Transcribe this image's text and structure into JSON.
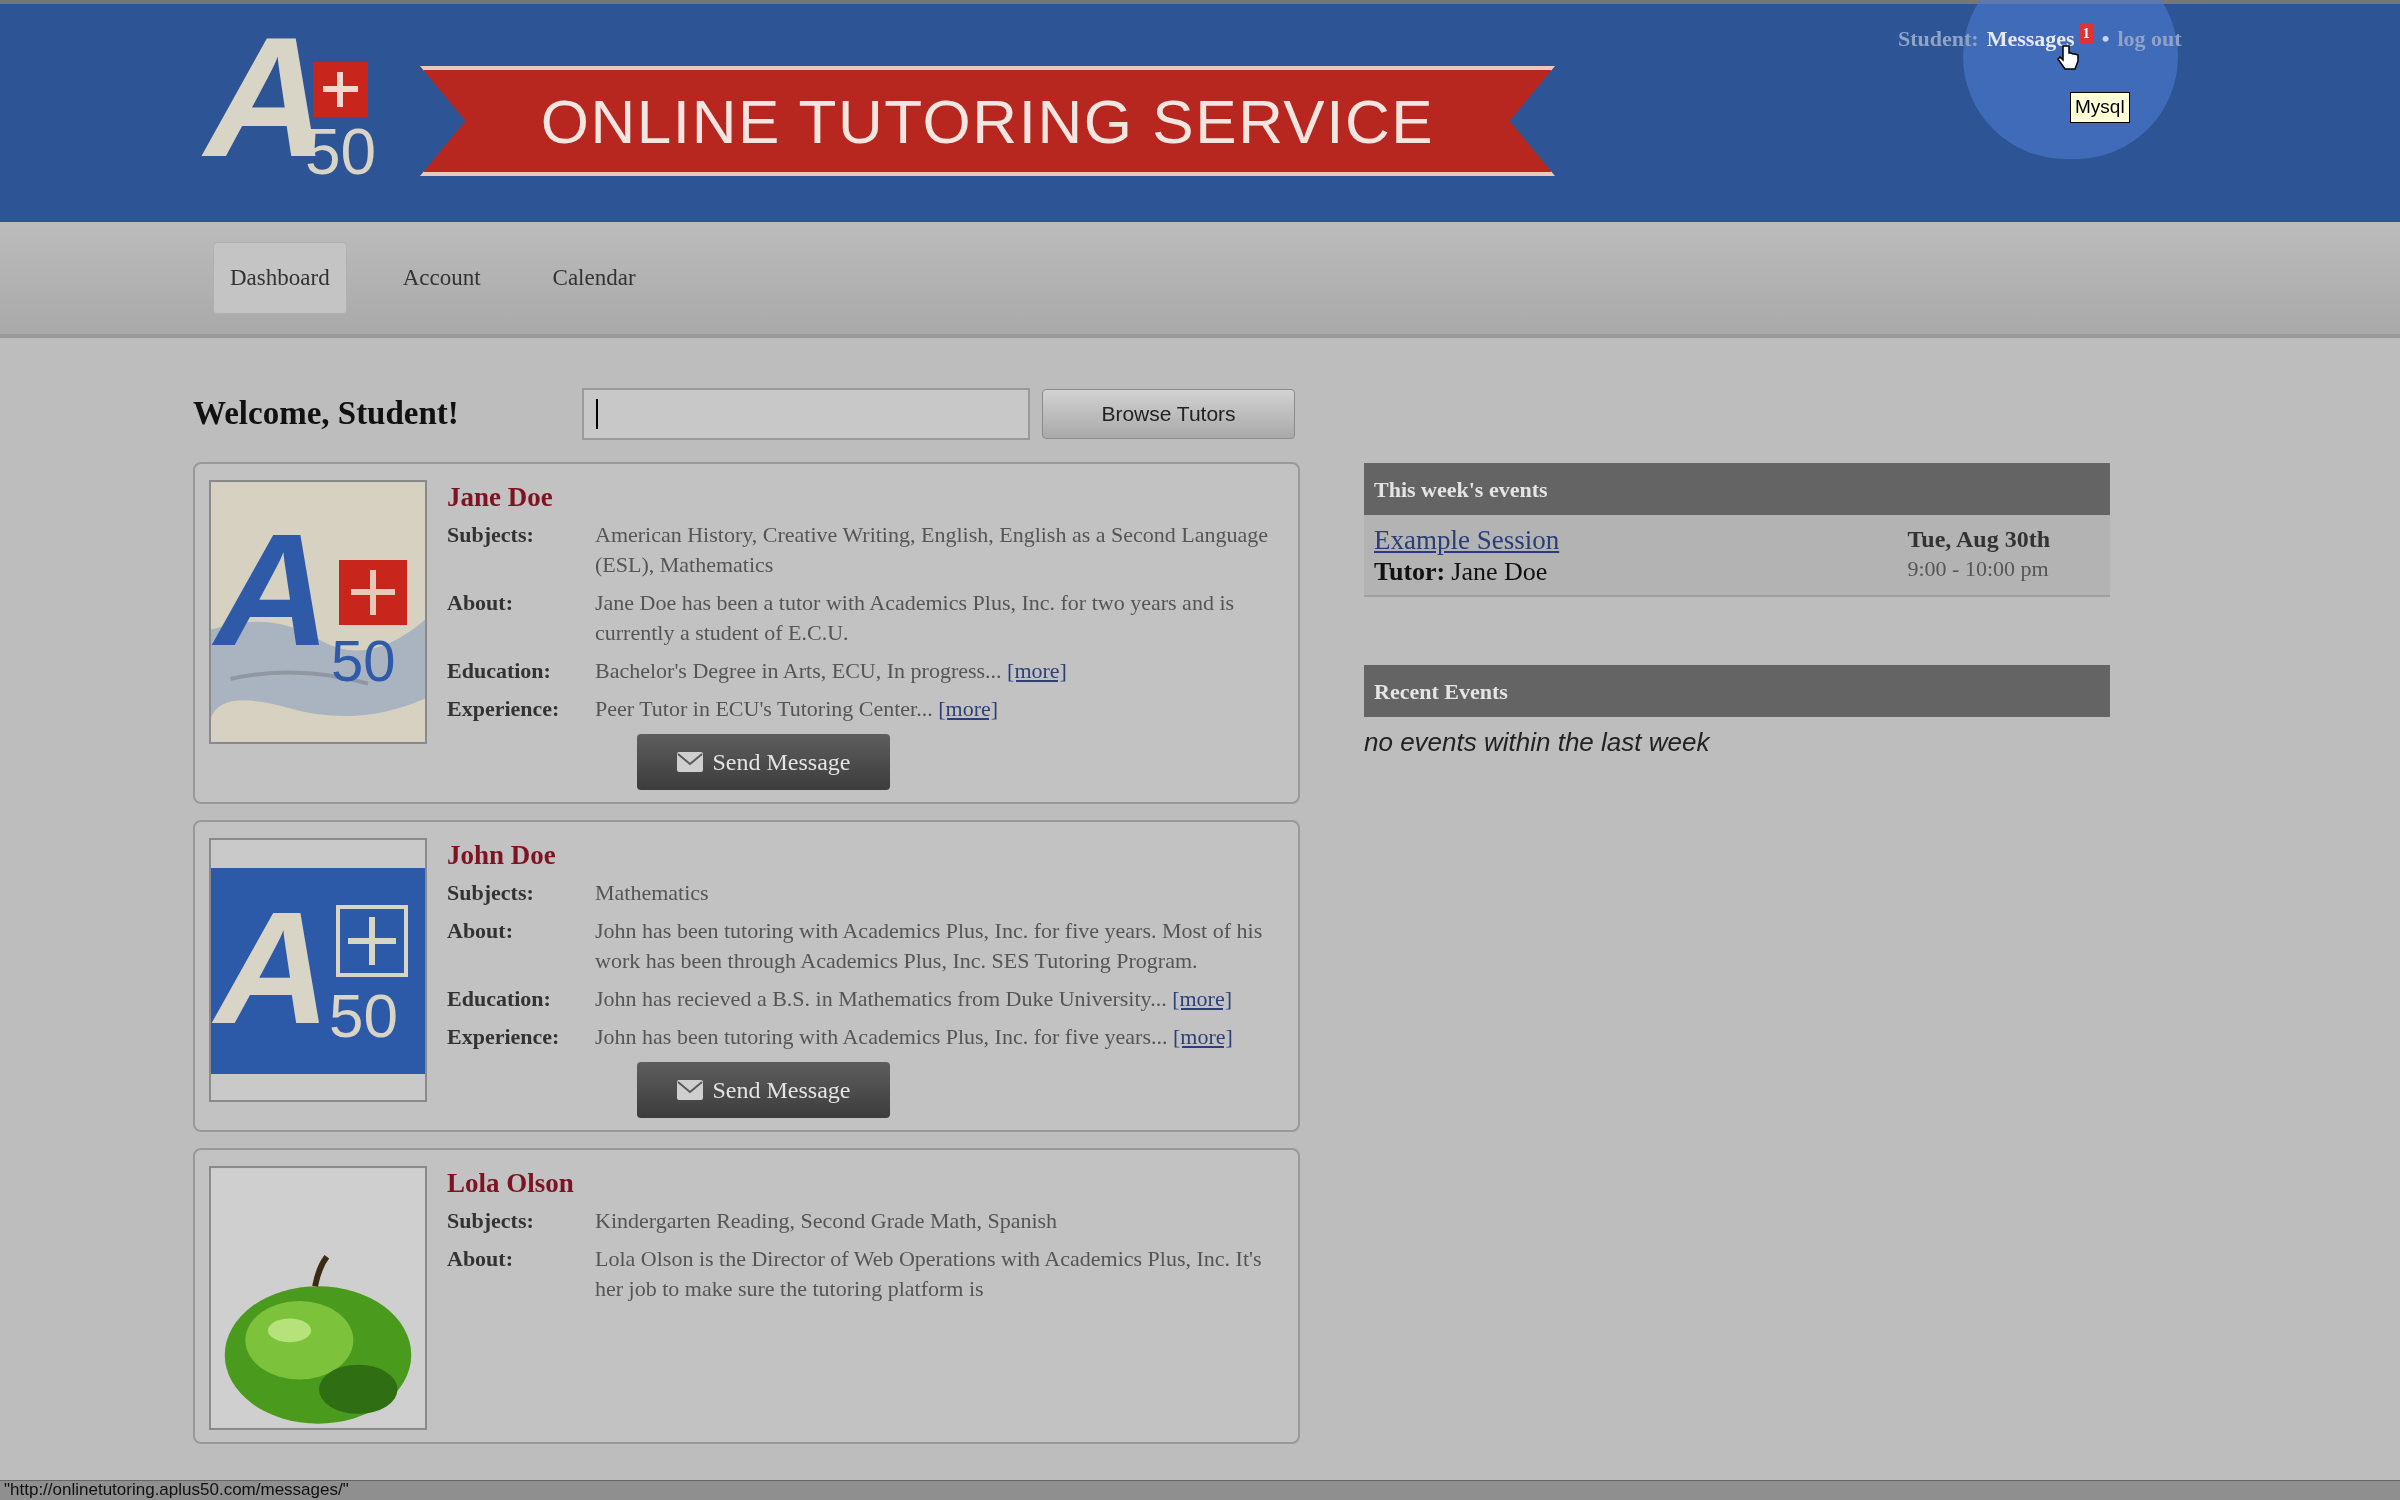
{
  "header": {
    "logo": {
      "letter": "A",
      "number": "50"
    },
    "banner": "ONLINE TUTORING SERVICE",
    "user_links": {
      "user": "Student:",
      "messages": "Messages",
      "badge": "1",
      "separator": "•",
      "logout": "log out"
    },
    "tooltip": "Mysql"
  },
  "nav": [
    {
      "label": "Dashboard",
      "selected": true
    },
    {
      "label": "Account",
      "selected": false
    },
    {
      "label": "Calendar",
      "selected": false
    }
  ],
  "welcome": "Welcome, Student!",
  "search": {
    "button": "Browse Tutors"
  },
  "tutors": [
    {
      "name": "Jane Doe",
      "avatar": {
        "kind": "logo_map",
        "letter": "A",
        "number": "50"
      },
      "fields": [
        {
          "label": "Subjects:",
          "text": "American History,  Creative Writing,  English,  English as a Second Language (ESL),  Mathematics"
        },
        {
          "label": "About:",
          "text": "Jane Doe has been a tutor with Academics Plus, Inc. for two years and is currently a student of E.C.U."
        },
        {
          "label": "Education:",
          "text": "Bachelor's Degree in Arts, ECU, In progress...",
          "link": "[more]"
        },
        {
          "label": "Experience:",
          "text": "Peer Tutor in ECU's Tutoring Center...",
          "link": "[more]"
        }
      ],
      "button": "Send Message"
    },
    {
      "name": "John Doe",
      "avatar": {
        "kind": "logo_blue",
        "letter": "A",
        "number": "50"
      },
      "fields": [
        {
          "label": "Subjects:",
          "text": "Mathematics"
        },
        {
          "label": "About:",
          "text": "John has been tutoring with Academics Plus, Inc. for five years. Most of his work has been through Academics Plus, Inc. SES Tutoring Program."
        },
        {
          "label": "Education:",
          "text": "John has recieved a B.S. in Mathematics from Duke University...",
          "link": "[more]"
        },
        {
          "label": "Experience:",
          "text": "John has been tutoring with Academics Plus, Inc. for five years...",
          "link": "[more]"
        }
      ],
      "button": "Send Message"
    },
    {
      "name": "Lola Olson",
      "avatar": {
        "kind": "picture"
      },
      "fields": [
        {
          "label": "Subjects:",
          "text": "Kindergarten Reading,  Second Grade Math,  Spanish"
        },
        {
          "label": "About:",
          "text": "Lola Olson is the Director of Web Operations with Academics Plus, Inc. It's her job to make sure the tutoring platform is"
        }
      ]
    }
  ],
  "this_week": {
    "title": "This week's events",
    "events": [
      {
        "name": "Example Session",
        "tutor_label": "Tutor:",
        "tutor": "Jane Doe",
        "date": "Tue, Aug 30th",
        "time": "9:00 - 10:00 pm"
      }
    ]
  },
  "recent": {
    "title": "Recent Events",
    "empty": "no events within the last week"
  },
  "status_bar": "\"http://onlinetutoring.aplus50.com/messages/\""
}
